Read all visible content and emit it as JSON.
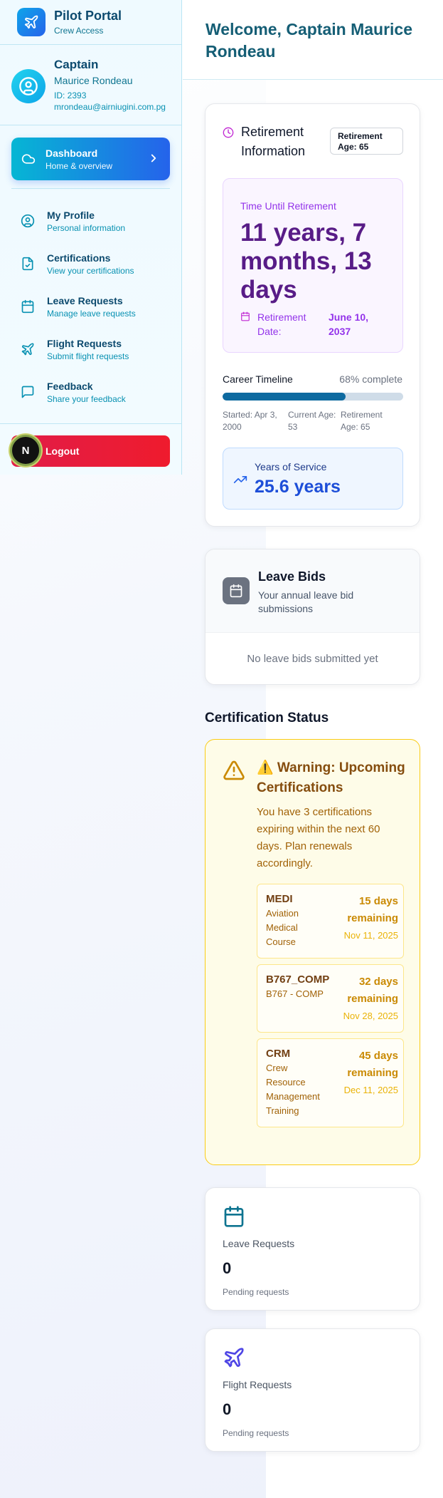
{
  "brand": {
    "title": "Pilot Portal",
    "subtitle": "Crew Access"
  },
  "profile": {
    "rank": "Captain",
    "name": "Maurice Rondeau",
    "id": "ID: 2393",
    "email": "mrondeau@airniugini.com.pg"
  },
  "dashboard": {
    "title": "Dashboard",
    "subtitle": "Home & overview"
  },
  "nav": [
    {
      "title": "My Profile",
      "subtitle": "Personal information",
      "icon": "user-circle-icon"
    },
    {
      "title": "Certifications",
      "subtitle": "View your certifications",
      "icon": "file-check-icon"
    },
    {
      "title": "Leave Requests",
      "subtitle": "Manage leave requests",
      "icon": "calendar-icon"
    },
    {
      "title": "Flight Requests",
      "subtitle": "Submit flight requests",
      "icon": "plane-icon"
    },
    {
      "title": "Feedback",
      "subtitle": "Share your feedback",
      "icon": "message-icon"
    }
  ],
  "logout": {
    "label": "Logout",
    "badge": "N"
  },
  "header": {
    "title": "Welcome, Captain Maurice Rondeau"
  },
  "retirement": {
    "title": "Retirement Information",
    "age_badge": "Retirement Age: 65",
    "time_label": "Time Until Retirement",
    "time_value": "11 years, 7 months, 13 days",
    "date_label": "Retirement Date:",
    "date_value": "June 10, 2037",
    "timeline_label": "Career Timeline",
    "timeline_pct_text": "68% complete",
    "timeline_progress": 0.68,
    "started": "Started: Apr 3, 2000",
    "current_age": "Current Age: 53",
    "retirement_age": "Retirement Age: 65",
    "service_label": "Years of Service",
    "service_value": "25.6 years"
  },
  "leave_bids": {
    "title": "Leave Bids",
    "subtitle": "Your annual leave bid submissions",
    "empty": "No leave bids submitted yet"
  },
  "cert_section": {
    "title": "Certification Status"
  },
  "warning": {
    "title": "⚠️ Warning: Upcoming Certifications",
    "text": "You have 3 certifications expiring within the next 60 days. Plan renewals accordingly.",
    "items": [
      {
        "code": "MEDI",
        "name": "Aviation Medical Course",
        "days": "15 days remaining",
        "date": "Nov 11, 2025"
      },
      {
        "code": "B767_COMP",
        "name": "B767 - COMP",
        "days": "32 days remaining",
        "date": "Nov 28, 2025"
      },
      {
        "code": "CRM",
        "name": "Crew Resource Management Training",
        "days": "45 days remaining",
        "date": "Dec 11, 2025"
      }
    ]
  },
  "stats": [
    {
      "label": "Leave Requests",
      "value": "0",
      "sub": "Pending requests",
      "color": "#0e7490"
    },
    {
      "label": "Flight Requests",
      "value": "0",
      "sub": "Pending requests",
      "color": "#4f46e5"
    }
  ]
}
